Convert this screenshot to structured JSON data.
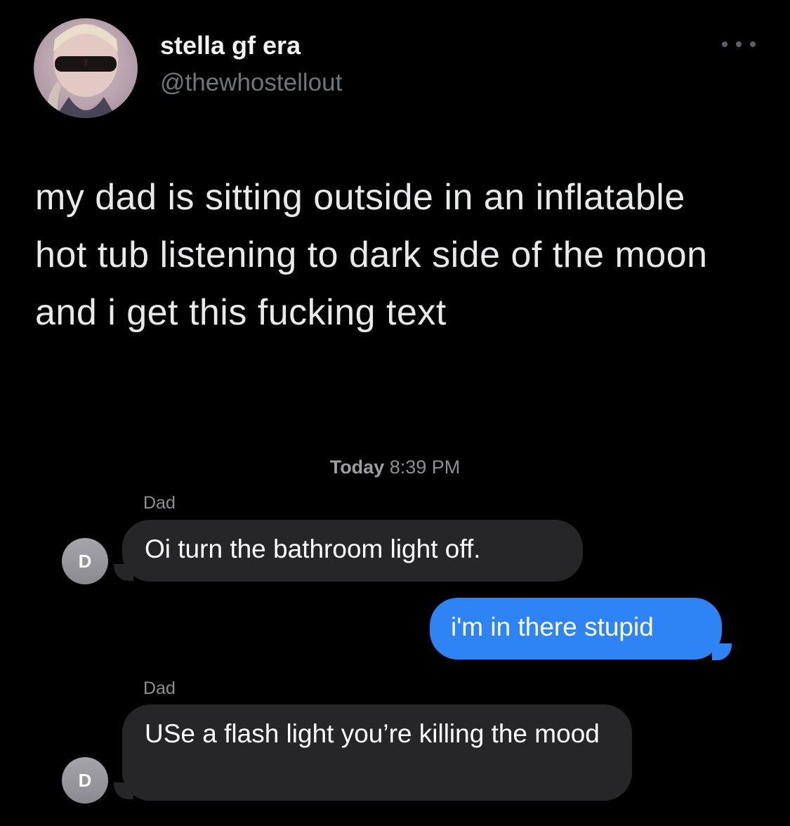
{
  "tweet": {
    "display_name": "stella gf era",
    "handle": "@thewhostellout",
    "avatar_icon": "profile-photo",
    "more_icon": "more-options-icon",
    "text": "my dad is sitting outside in an inflatable hot tub listening to dark side of the moon and i get this fucking text"
  },
  "conversation": {
    "timestamp_day": "Today",
    "timestamp_time": "8:39 PM",
    "messages": [
      {
        "direction": "incoming",
        "sender": "Dad",
        "avatar_initial": "D",
        "text": "Oi turn the bathroom light off."
      },
      {
        "direction": "outgoing",
        "text": "i'm in there stupid"
      },
      {
        "direction": "incoming",
        "sender": "Dad",
        "avatar_initial": "D",
        "text": "USe a flash light you’re killing the mood"
      }
    ]
  },
  "colors": {
    "background": "#000000",
    "incoming_bubble": "#262629",
    "outgoing_bubble": "#2f84f5",
    "secondary_text": "#71767b"
  }
}
